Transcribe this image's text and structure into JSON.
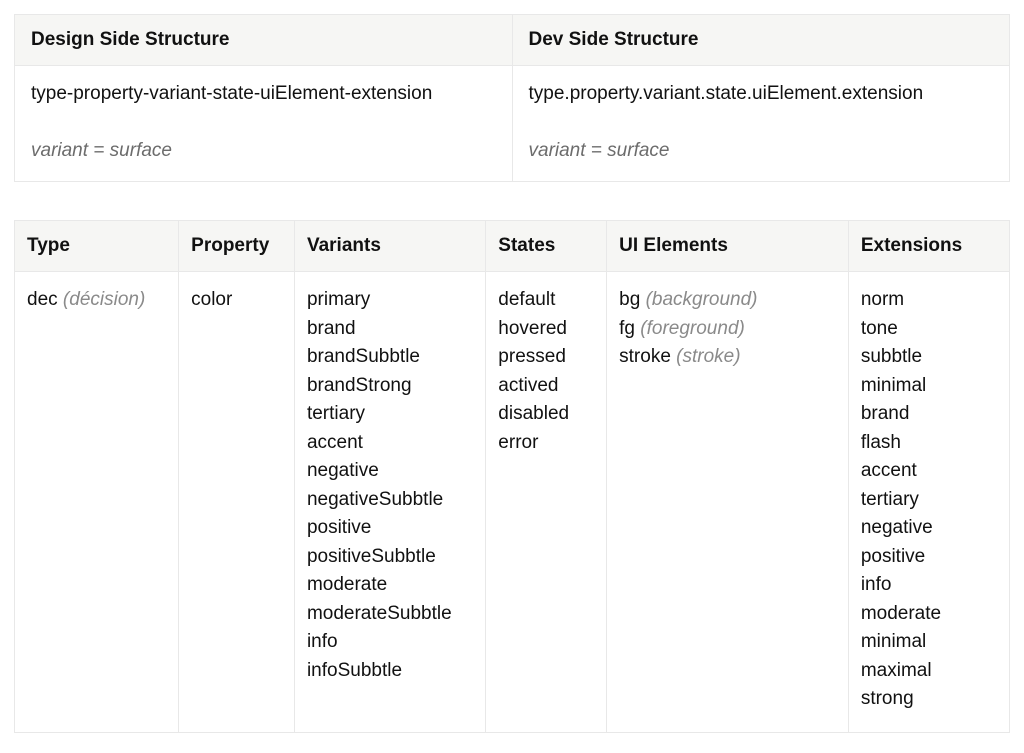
{
  "struct": {
    "design_heading": "Design Side Structure",
    "dev_heading": "Dev Side Structure",
    "design_pattern": "type-property-variant-state-uiElement-extension",
    "dev_pattern": "type.property.variant.state.uiElement.extension",
    "design_note": "variant = surface",
    "dev_note": "variant = surface"
  },
  "headers": {
    "type": "Type",
    "property": "Property",
    "variants": "Variants",
    "states": "States",
    "uiElements": "UI Elements",
    "extensions": "Extensions"
  },
  "columns": {
    "type": [
      {
        "label": "dec",
        "note": "(décision)"
      }
    ],
    "property": [
      {
        "label": "color"
      }
    ],
    "variants": [
      {
        "label": "primary"
      },
      {
        "label": "brand"
      },
      {
        "label": "brandSubbtle"
      },
      {
        "label": "brandStrong"
      },
      {
        "label": "tertiary"
      },
      {
        "label": "accent"
      },
      {
        "label": "negative"
      },
      {
        "label": "negativeSubbtle"
      },
      {
        "label": "positive"
      },
      {
        "label": "positiveSubbtle"
      },
      {
        "label": "moderate"
      },
      {
        "label": "moderateSubbtle"
      },
      {
        "label": "info"
      },
      {
        "label": "infoSubbtle"
      }
    ],
    "states": [
      {
        "label": "default"
      },
      {
        "label": "hovered"
      },
      {
        "label": "pressed"
      },
      {
        "label": "actived"
      },
      {
        "label": "disabled"
      },
      {
        "label": "error"
      }
    ],
    "uiElements": [
      {
        "label": "bg",
        "note": "(background)"
      },
      {
        "label": "fg",
        "note": "(foreground)"
      },
      {
        "label": "stroke",
        "note": "(stroke)"
      }
    ],
    "extensions": [
      {
        "label": "norm"
      },
      {
        "label": "tone"
      },
      {
        "label": "subbtle"
      },
      {
        "label": "minimal"
      },
      {
        "label": "brand"
      },
      {
        "label": "flash"
      },
      {
        "label": "accent"
      },
      {
        "label": "tertiary"
      },
      {
        "label": "negative"
      },
      {
        "label": "positive"
      },
      {
        "label": "info"
      },
      {
        "label": "moderate"
      },
      {
        "label": "minimal"
      },
      {
        "label": "maximal"
      },
      {
        "label": "strong"
      }
    ]
  }
}
